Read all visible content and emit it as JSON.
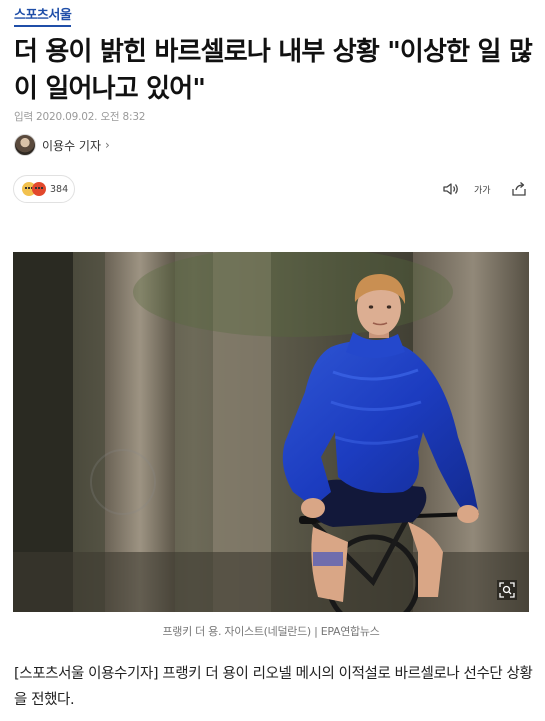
{
  "press": {
    "logo_text": "스포츠서울",
    "brand_color": "#1f4ea8"
  },
  "article": {
    "headline": "더 용이 밝힌 바르셀로나 내부 상황 \"이상한 일 많이 일어나고 있어\"",
    "date_label": "입력 2020.09.02. 오전 8:32",
    "reporter": {
      "name": "이용수 기자",
      "chevron": "›"
    },
    "reactions": {
      "count": "384",
      "icons": [
        "sad-emoji-icon",
        "angry-emoji-icon"
      ]
    },
    "tools": {
      "audio_icon": "speaker-icon",
      "font_label": "가가",
      "share_icon": "share-icon"
    },
    "photo": {
      "subject": "cyclist in blue puffer jacket",
      "zoom_icon": "zoom-icon"
    },
    "caption": "프랭키 더 용. 자이스트(네덜란드) | EPA연합뉴스",
    "body": "[스포츠서울 이용수기자] 프랭키 더 용이 리오넬 메시의 이적설로 바르셀로나 선수단 상황을 전했다."
  }
}
